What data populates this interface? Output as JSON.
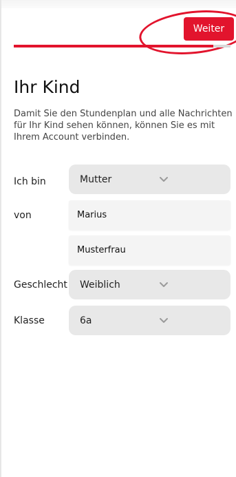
{
  "header": {
    "next_label": "Weiter",
    "progress_fraction": 0.92
  },
  "page": {
    "title": "Ihr Kind",
    "intro": "Damit Sie den Stundenplan und alle Nachrichten für Ihr Kind sehen können, können Sie es mit Ihrem Account verbinden."
  },
  "form": {
    "relation_label": "Ich bin",
    "relation_value": "Mutter",
    "of_label": "von",
    "first_name_value": "Marius",
    "last_name_value": "Musterfrau",
    "gender_label": "Geschlecht",
    "gender_value": "Weiblich",
    "class_label": "Klasse",
    "class_value": "6a"
  },
  "colors": {
    "accent": "#e2142d",
    "select_bg": "#e8e8e8",
    "field_bg": "#f4f4f4"
  },
  "icons": {
    "dropdown": "chevron-down-icon"
  }
}
